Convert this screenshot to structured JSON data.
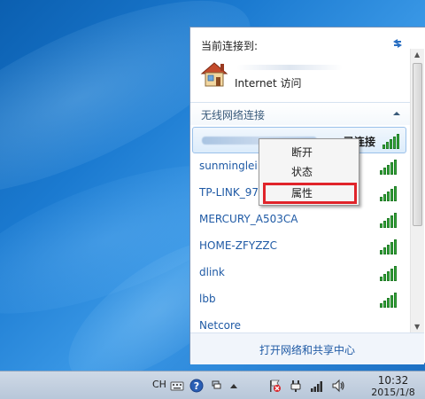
{
  "flyout": {
    "connected_title": "当前连接到:",
    "internet_label": "Internet 访问",
    "wireless_header": "无线网络连接",
    "footer_link": "打开网络和共享中心"
  },
  "networks": [
    {
      "name": "",
      "status": "已连接",
      "selected": true
    },
    {
      "name": "sunminglei",
      "status": ""
    },
    {
      "name": "TP-LINK_97",
      "status": ""
    },
    {
      "name": "MERCURY_A503CA",
      "status": ""
    },
    {
      "name": "HOME-ZFYZZC",
      "status": ""
    },
    {
      "name": "dlink",
      "status": ""
    },
    {
      "name": "lbb",
      "status": ""
    },
    {
      "name": "Netcore",
      "status": ""
    }
  ],
  "context_menu": {
    "items": [
      "断开",
      "状态",
      "属性"
    ],
    "highlighted": "属性"
  },
  "taskbar": {
    "language": "CH",
    "time": "10:32",
    "date": "2015/1/8"
  },
  "icons": {
    "refresh": "refresh-icon",
    "house": "house-icon",
    "collapse": "chevron-up-icon",
    "signal": "wifi-signal-icon"
  },
  "colors": {
    "link": "#1f5aa5",
    "signal": "#35a83a",
    "highlight_box": "#e0242a"
  }
}
